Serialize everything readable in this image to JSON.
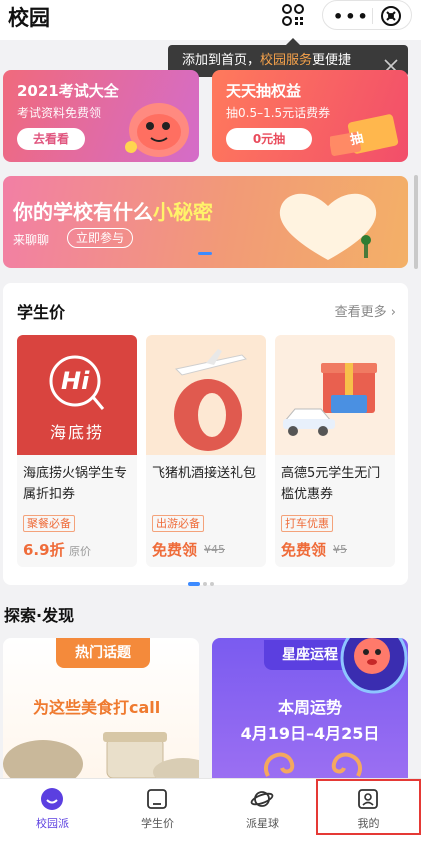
{
  "header": {
    "title": "校园"
  },
  "tooltip": {
    "prefix": "添加到首页，",
    "highlight": "校园服务",
    "suffix": "更便捷"
  },
  "promos": [
    {
      "title": "2021考试大全",
      "subtitle": "考试资料免费领",
      "button": "去看看"
    },
    {
      "title": "天天抽权益",
      "subtitle": "抽0.5–1.5元话费券",
      "button": "0元抽",
      "badge": "抽"
    }
  ],
  "banner": {
    "title_prefix": "你的学校有什么",
    "title_highlight": "小秘密",
    "subtitle": "来聊聊",
    "button": "立即参与"
  },
  "student": {
    "title": "学生价",
    "more": "查看更多 ›",
    "items": [
      {
        "image_text": "海底捞",
        "logo_text": "Hi",
        "name": "海底捞火锅学生专属折扣券",
        "tag": "聚餐必备",
        "price": "6.9折",
        "original": "原价"
      },
      {
        "name": "飞猪机酒接送礼包",
        "tag": "出游必备",
        "price": "免费领",
        "original": "¥45"
      },
      {
        "name": "高德5元学生无门槛优惠券",
        "tag": "打车优惠",
        "price": "免费领",
        "original": "¥5"
      }
    ]
  },
  "explore": {
    "title": "探索·发现",
    "hot": {
      "tag": "热门话题",
      "text": "为这些美食打call"
    },
    "star": {
      "tag": "星座运程",
      "line1": "本周运势",
      "line2": "4月19日–4月25日"
    }
  },
  "tabs": [
    {
      "label": "校园派"
    },
    {
      "label": "学生价"
    },
    {
      "label": "派星球"
    },
    {
      "label": "我的"
    }
  ],
  "colors": {
    "accent": "#5b3fe0",
    "orange": "#ef6c3a",
    "blue_dot": "#3d8bff"
  }
}
